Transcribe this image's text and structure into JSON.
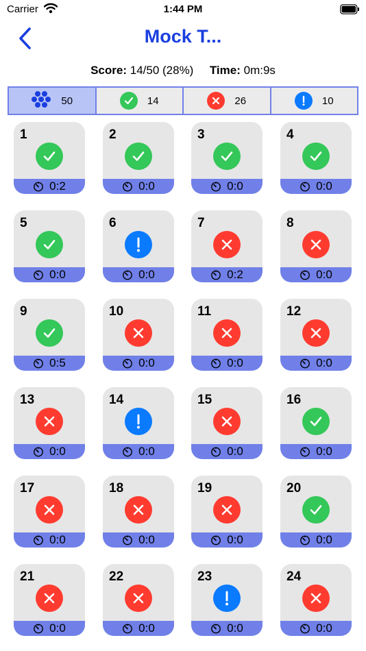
{
  "status_bar": {
    "carrier": "Carrier",
    "time": "1:44 PM"
  },
  "nav": {
    "title": "Mock T..."
  },
  "summary": {
    "score_label": "Score:",
    "score_value": "14/50 (28%)",
    "time_label": "Time:",
    "time_value": "0m:9s"
  },
  "filters": [
    {
      "id": "all",
      "icon": "dots-icon",
      "count": "50",
      "selected": true
    },
    {
      "id": "correct",
      "icon": "check-icon",
      "count": "14",
      "selected": false
    },
    {
      "id": "wrong",
      "icon": "x-icon",
      "count": "26",
      "selected": false
    },
    {
      "id": "skipped",
      "icon": "exclamation-icon",
      "count": "10",
      "selected": false
    }
  ],
  "colors": {
    "accent": "#1a3fe0",
    "bar": "#7080e8",
    "correct": "#34c759",
    "wrong": "#ff3b30",
    "skipped": "#0a7aff"
  },
  "questions": [
    {
      "number": "1",
      "status": "correct",
      "time": "0:2"
    },
    {
      "number": "2",
      "status": "correct",
      "time": "0:0"
    },
    {
      "number": "3",
      "status": "correct",
      "time": "0:0"
    },
    {
      "number": "4",
      "status": "correct",
      "time": "0:0"
    },
    {
      "number": "5",
      "status": "correct",
      "time": "0:0"
    },
    {
      "number": "6",
      "status": "skipped",
      "time": "0:0"
    },
    {
      "number": "7",
      "status": "wrong",
      "time": "0:2"
    },
    {
      "number": "8",
      "status": "wrong",
      "time": "0:0"
    },
    {
      "number": "9",
      "status": "correct",
      "time": "0:5"
    },
    {
      "number": "10",
      "status": "wrong",
      "time": "0:0"
    },
    {
      "number": "11",
      "status": "wrong",
      "time": "0:0"
    },
    {
      "number": "12",
      "status": "wrong",
      "time": "0:0"
    },
    {
      "number": "13",
      "status": "wrong",
      "time": "0:0"
    },
    {
      "number": "14",
      "status": "skipped",
      "time": "0:0"
    },
    {
      "number": "15",
      "status": "wrong",
      "time": "0:0"
    },
    {
      "number": "16",
      "status": "correct",
      "time": "0:0"
    },
    {
      "number": "17",
      "status": "wrong",
      "time": "0:0"
    },
    {
      "number": "18",
      "status": "wrong",
      "time": "0:0"
    },
    {
      "number": "19",
      "status": "wrong",
      "time": "0:0"
    },
    {
      "number": "20",
      "status": "correct",
      "time": "0:0"
    },
    {
      "number": "21",
      "status": "wrong",
      "time": "0:0"
    },
    {
      "number": "22",
      "status": "wrong",
      "time": "0:0"
    },
    {
      "number": "23",
      "status": "skipped",
      "time": "0:0"
    },
    {
      "number": "24",
      "status": "wrong",
      "time": "0:0"
    }
  ]
}
